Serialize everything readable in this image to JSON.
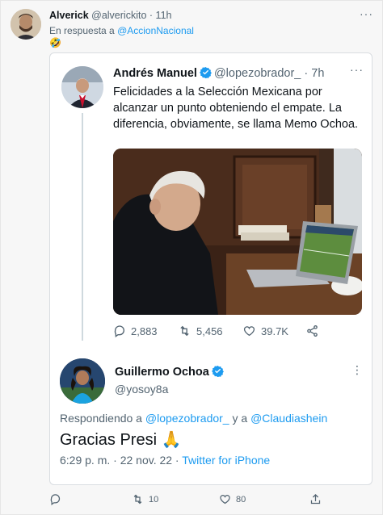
{
  "reply_tweet": {
    "name": "Alverick",
    "handle": "@alverickito",
    "dot": "·",
    "time": "11h",
    "reply_prefix": "En respuesta a",
    "reply_to": "@AccionNacional",
    "emoji": "🤣",
    "more_icon": "more-dots-icon",
    "actions": {
      "reply_count": "",
      "retweet_count": "10",
      "like_count": "80"
    }
  },
  "quoted_image": {
    "amlo_tweet": {
      "name": "Andrés Manuel",
      "handle": "@lopezobrador_",
      "dot": "·",
      "time": "7h",
      "text": "Felicidades a la Selección Mexicana por alcanzar un punto obteniendo el empate. La diferencia, obviamente, se llama Memo Ochoa.",
      "photo_alt": "Photo of a man watching a football match on a laptop",
      "actions": {
        "replies": "2,883",
        "retweets": "5,456",
        "likes": "39.7K"
      }
    },
    "ochoa_tweet": {
      "name": "Guillermo Ochoa",
      "handle": "@yosoy8a",
      "reply_prefix": "Respondiendo a",
      "reply_mention_1": "@lopezobrador_",
      "reply_join": "y a",
      "reply_mention_2": "@Claudiashein",
      "text": "Gracias Presi",
      "text_emoji": "🙏",
      "timestamp": "6:29 p. m. · 22 nov. 22 ·",
      "source": "Twitter for iPhone"
    }
  },
  "colors": {
    "link": "#1d9bf0",
    "muted": "#536471",
    "verified": "#1d9bf0",
    "text": "#0f1419"
  }
}
